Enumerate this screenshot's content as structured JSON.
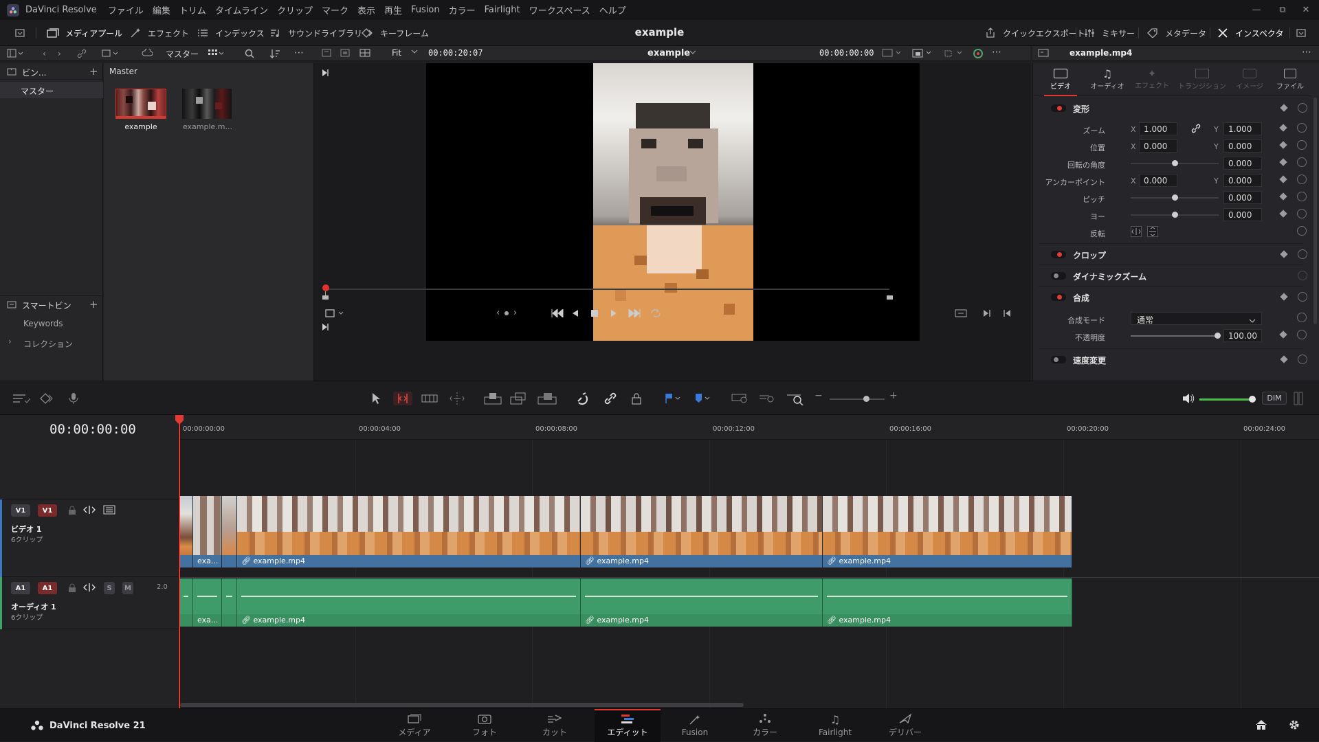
{
  "app": {
    "name": "DaVinci Resolve",
    "product_label": "DaVinci Resolve 21"
  },
  "menu": [
    "ファイル",
    "編集",
    "トリム",
    "タイムライン",
    "クリップ",
    "マーク",
    "表示",
    "再生",
    "Fusion",
    "カラー",
    "Fairlight",
    "ワークスペース",
    "ヘルプ"
  ],
  "toolbar": {
    "media_pool": "メディアプール",
    "effects": "エフェクト",
    "index": "インデックス",
    "sound_library": "サウンドライブラリ",
    "keyframes": "キーフレーム",
    "project_title": "example",
    "quick_export": "クイックエクスポート",
    "mixer": "ミキサー",
    "metadata": "メタデータ",
    "inspector": "インスペクタ"
  },
  "bins": {
    "header": "ビン...",
    "master_dropdown": "マスター",
    "items": [
      "マスター"
    ],
    "smart_bins_header": "スマートビン",
    "smart_items": [
      "Keywords",
      "コレクション"
    ]
  },
  "media_pool": {
    "breadcrumb": "Master",
    "clips": [
      {
        "name": "example",
        "selected": true
      },
      {
        "name": "example.m...",
        "selected": false
      }
    ]
  },
  "viewer": {
    "zoom": "Fit",
    "duration_timecode": "00:00:20:07",
    "clip_name": "example",
    "current_timecode": "00:00:00:00"
  },
  "inspector": {
    "file_name": "example.mp4",
    "tabs": [
      {
        "label": "ビデオ",
        "active": true,
        "icon": "video-icon"
      },
      {
        "label": "オーディオ",
        "active": false,
        "icon": "music-icon"
      },
      {
        "label": "エフェクト",
        "active": false,
        "icon": "effects-icon"
      },
      {
        "label": "トランジション",
        "active": false,
        "icon": "transition-icon"
      },
      {
        "label": "イメージ",
        "active": false,
        "icon": "image-icon"
      },
      {
        "label": "ファイル",
        "active": false,
        "icon": "file-icon"
      }
    ],
    "transform": {
      "title": "変形",
      "zoom_label": "ズーム",
      "zoom_x": "1.000",
      "zoom_y": "1.000",
      "position_label": "位置",
      "position_x": "0.000",
      "position_y": "0.000",
      "rotation_label": "回転の角度",
      "rotation": "0.000",
      "anchor_label": "アンカーポイント",
      "anchor_x": "0.000",
      "anchor_y": "0.000",
      "pitch_label": "ピッチ",
      "pitch": "0.000",
      "yaw_label": "ヨー",
      "yaw": "0.000",
      "flip_label": "反転"
    },
    "sections": {
      "crop": "クロップ",
      "dynamic_zoom": "ダイナミックズーム",
      "composite": "合成",
      "composite_mode_label": "合成モード",
      "composite_mode": "通常",
      "opacity_label": "不透明度",
      "opacity": "100.00",
      "speed_change": "速度変更"
    }
  },
  "timeline": {
    "timecode": "00:00:00:00",
    "ruler_labels": [
      "00:00:00:00",
      "00:00:04:00",
      "00:00:08:00",
      "00:00:12:00",
      "00:00:16:00",
      "00:00:20:00",
      "00:00:24:00"
    ],
    "audio_level": "DIM",
    "tracks": {
      "video": {
        "id": "V1",
        "name": "ビデオ 1",
        "clips_count": "6クリップ"
      },
      "audio": {
        "id": "A1",
        "name": "オーディオ 1",
        "clips_count": "6クリップ",
        "solo": "S",
        "mute": "M",
        "volume": "2.0"
      }
    },
    "video_clips": [
      "exa...",
      "",
      "example.mp4",
      "example.mp4",
      "example.mp4"
    ],
    "audio_clips": [
      "exa...",
      "",
      "example.mp4",
      "example.mp4",
      "example.mp4"
    ]
  },
  "pages": [
    {
      "label": "メディア",
      "icon": "media-page-icon",
      "active": false
    },
    {
      "label": "フォト",
      "icon": "photo-page-icon",
      "active": false
    },
    {
      "label": "カット",
      "icon": "cut-page-icon",
      "active": false
    },
    {
      "label": "エディット",
      "icon": "edit-page-icon",
      "active": true
    },
    {
      "label": "Fusion",
      "icon": "fusion-page-icon",
      "active": false
    },
    {
      "label": "カラー",
      "icon": "color-page-icon",
      "active": false
    },
    {
      "label": "Fairlight",
      "icon": "fairlight-page-icon",
      "active": false
    },
    {
      "label": "デリバー",
      "icon": "deliver-page-icon",
      "active": false
    }
  ]
}
